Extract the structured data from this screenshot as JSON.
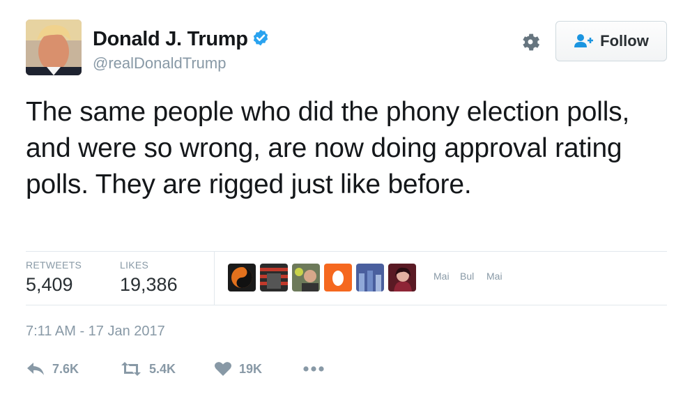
{
  "user": {
    "name": "Donald J. Trump",
    "handle": "@realDonaldTrump",
    "verified_color": "#2aa3ef"
  },
  "follow_button": {
    "label": "Follow",
    "icon": "add-user-icon"
  },
  "settings": {
    "icon": "gear-icon"
  },
  "tweet": {
    "text": "The same people who did the phony election polls, and were so wrong, are now doing approval rating polls. They are rigged just like before."
  },
  "stats": {
    "retweets_label": "RETWEETS",
    "retweets_value": "5,409",
    "likes_label": "LIKES",
    "likes_value": "19,386"
  },
  "likers_overflow": [
    "Mai",
    "Bul",
    "Mai"
  ],
  "timestamp": "7:11 AM - 17 Jan 2017",
  "actions": {
    "reply_count": "7.6K",
    "retweet_count": "5.4K",
    "like_count": "19K"
  },
  "colors": {
    "text": "#14171a",
    "muted": "#8899a6",
    "divider": "#e1e8ed"
  }
}
